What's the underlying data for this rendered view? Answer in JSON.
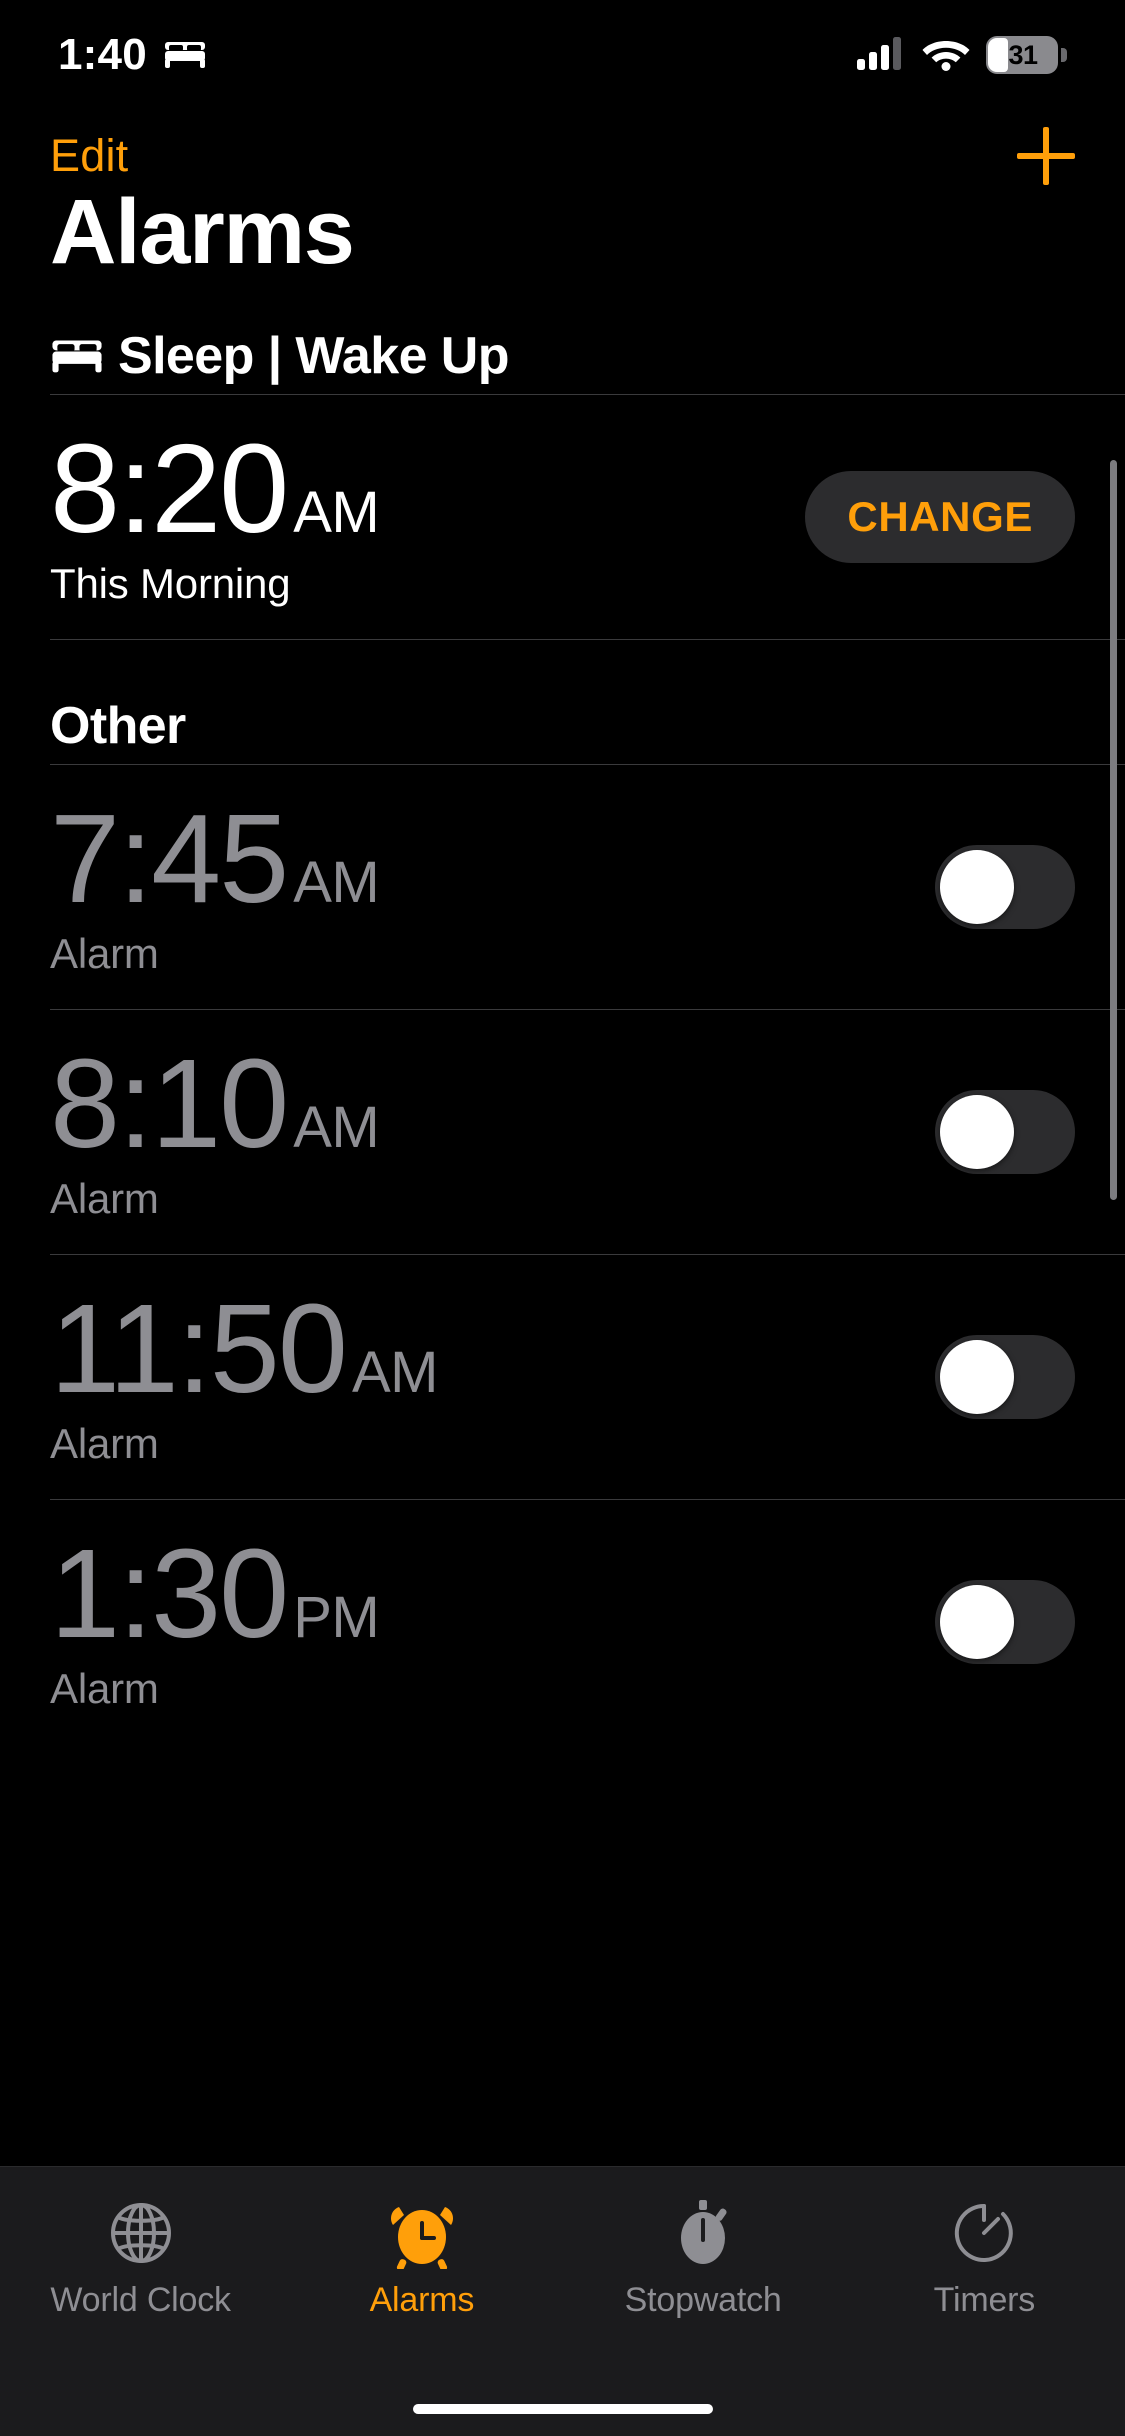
{
  "status_bar": {
    "time": "1:40",
    "focus_icon": "bed-icon",
    "cellular_icon": "cellular-signal-icon",
    "wifi_icon": "wifi-icon",
    "battery_percent": "31"
  },
  "nav": {
    "edit_label": "Edit",
    "add_icon": "plus-icon"
  },
  "page_title": "Alarms",
  "sections": [
    {
      "id": "sleep",
      "icon": "bed-icon",
      "title": "Sleep | Wake Up",
      "rows": [
        {
          "time": "8:20",
          "period": "AM",
          "label": "This Morning",
          "enabled": true,
          "action_label": "CHANGE",
          "control": "change-button"
        }
      ]
    },
    {
      "id": "other",
      "icon": null,
      "title": "Other",
      "rows": [
        {
          "time": "7:45",
          "period": "AM",
          "label": "Alarm",
          "enabled": false,
          "control": "toggle"
        },
        {
          "time": "8:10",
          "period": "AM",
          "label": "Alarm",
          "enabled": false,
          "control": "toggle"
        },
        {
          "time": "11:50",
          "period": "AM",
          "label": "Alarm",
          "enabled": false,
          "control": "toggle"
        },
        {
          "time": "1:30",
          "period": "PM",
          "label": "Alarm",
          "enabled": false,
          "control": "toggle"
        }
      ]
    }
  ],
  "tabs": [
    {
      "label": "World Clock",
      "icon": "globe-icon",
      "active": false
    },
    {
      "label": "Alarms",
      "icon": "alarm-clock-icon",
      "active": true
    },
    {
      "label": "Stopwatch",
      "icon": "stopwatch-icon",
      "active": false
    },
    {
      "label": "Timers",
      "icon": "timer-icon",
      "active": false
    }
  ],
  "colors": {
    "accent": "#FF9F0A",
    "background": "#000000",
    "disabled_text": "#8E8E93",
    "pill_background": "#2C2C2E",
    "divider": "#3A3A3C"
  }
}
